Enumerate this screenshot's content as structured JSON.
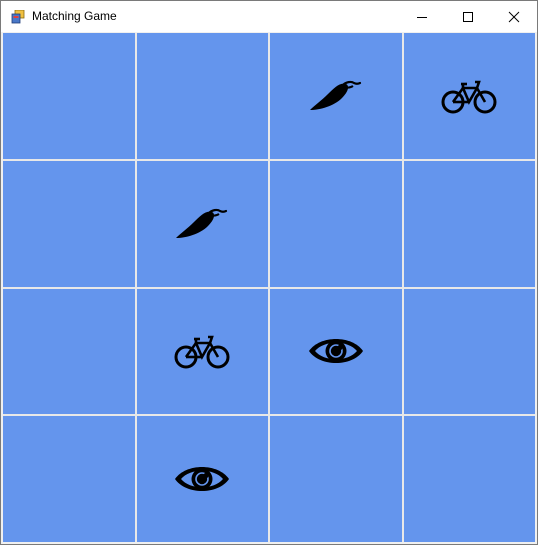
{
  "window": {
    "title": "Matching Game",
    "icon": "windows-forms-app-icon",
    "controls": [
      "minimize-icon",
      "maximize-icon",
      "close-icon"
    ]
  },
  "board": {
    "rows": 4,
    "cols": 4,
    "card_color": "#6495ed",
    "gap_color": "#e8e8e8",
    "cells": [
      [
        "",
        "",
        "chili-pepper",
        "bicycle"
      ],
      [
        "",
        "chili-pepper",
        "",
        ""
      ],
      [
        "",
        "bicycle",
        "eye",
        ""
      ],
      [
        "",
        "eye",
        "",
        ""
      ]
    ]
  }
}
